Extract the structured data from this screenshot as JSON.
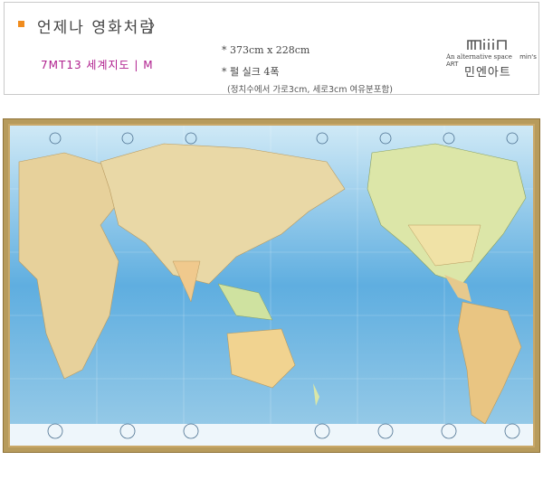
{
  "header": {
    "title": "언제나 영화처럼",
    "chevron": "〉",
    "model": "7MT13 세계지도 | M",
    "spec_size": "* 373cm x 228cm",
    "spec_material": "* 펄 실크 4폭",
    "spec_note": "(정치수에서 가로3cm, 세로3cm 여유분포함)"
  },
  "brand": {
    "logo_text": "miiin",
    "tagline": "An alternative space",
    "tagline_brand": "min's ART",
    "name": "민엔아트"
  },
  "map": {
    "description_icon": "world-map-pacific-centered",
    "frame_color": "#b79b5c"
  },
  "colors": {
    "bullet": "#f08c1e",
    "model_text": "#b0208e",
    "ocean": "#5aaee2",
    "land": "#e8d7a5"
  }
}
